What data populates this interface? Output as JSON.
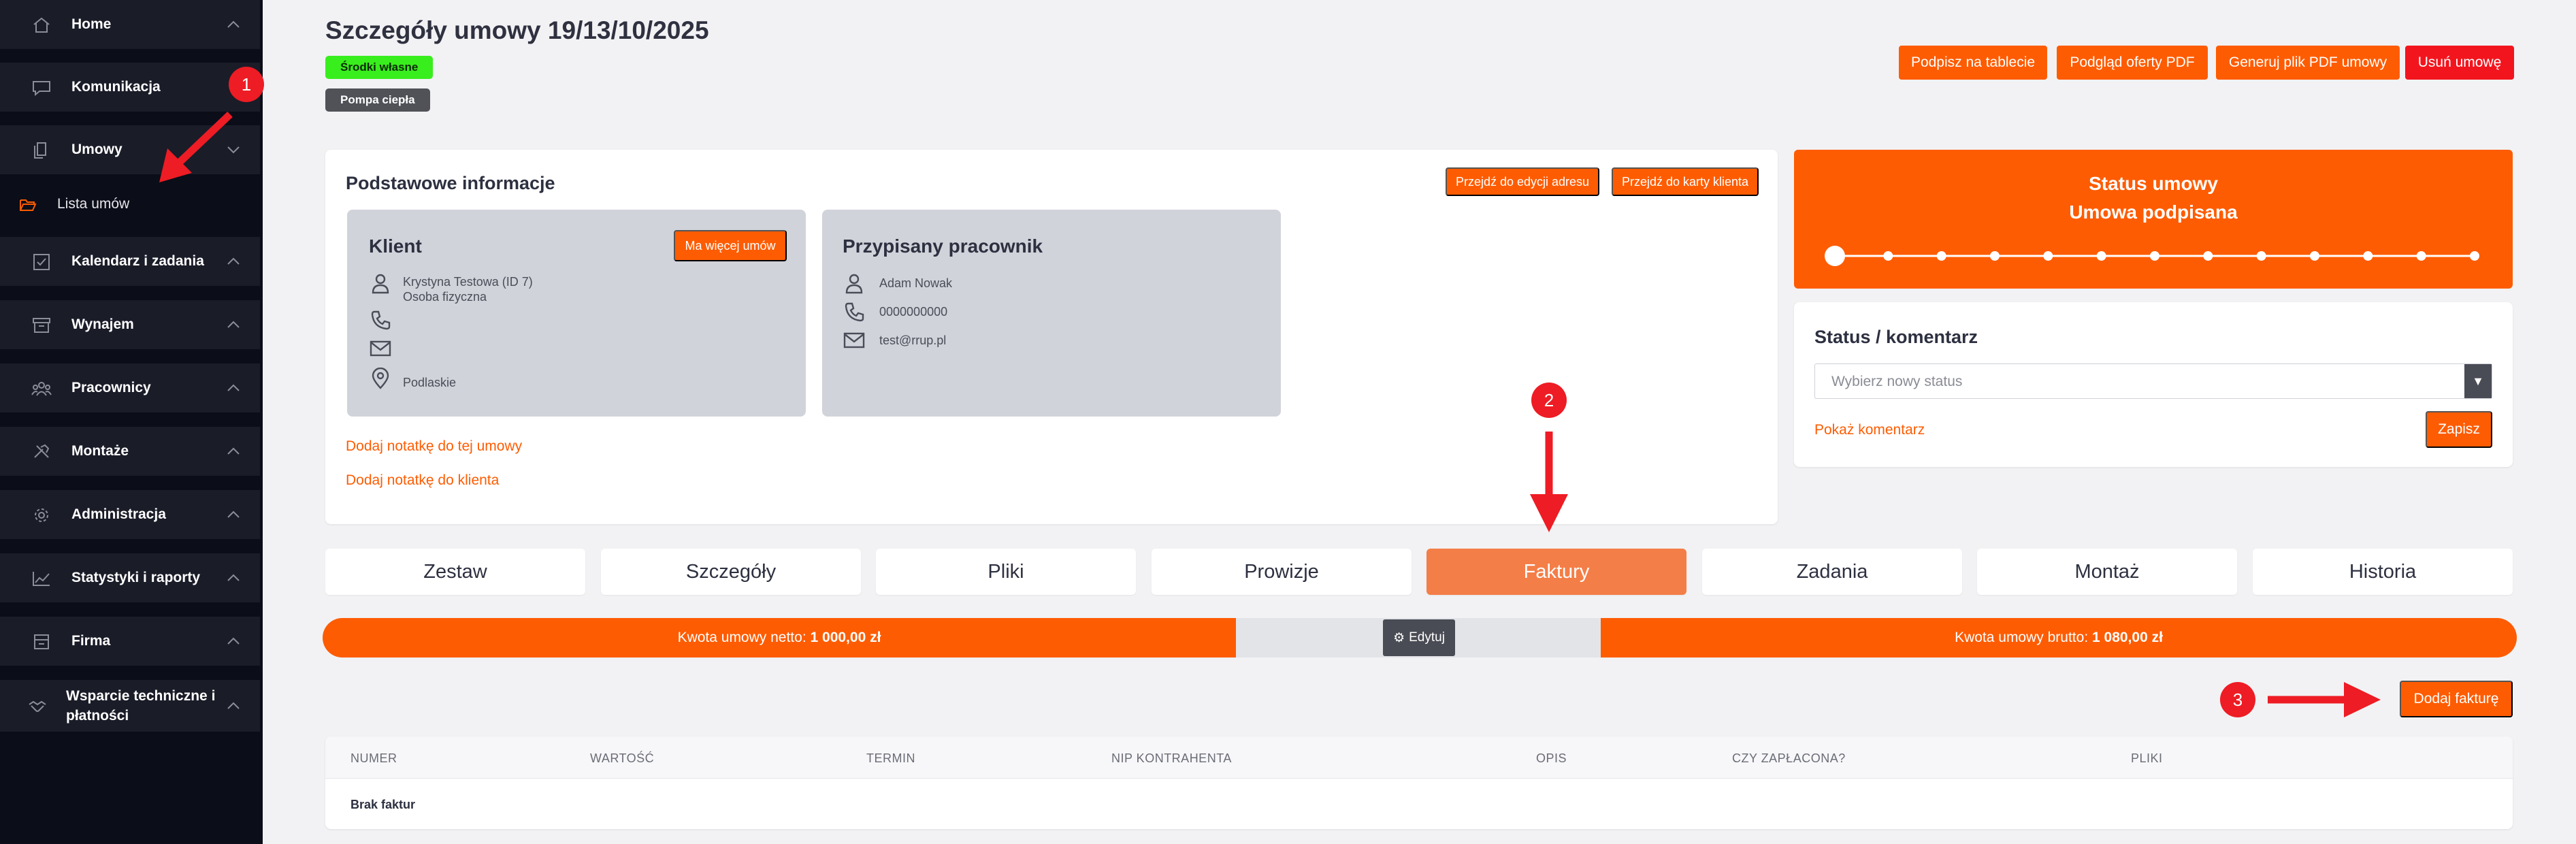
{
  "sidebar": {
    "items": [
      {
        "label": "Home",
        "icon": "home-icon"
      },
      {
        "label": "Komunikacja",
        "icon": "chat-icon"
      },
      {
        "label": "Umowy",
        "icon": "documents-icon"
      },
      {
        "label": "Kalendarz i zadania",
        "icon": "checkbox-icon"
      },
      {
        "label": "Wynajem",
        "icon": "box-icon"
      },
      {
        "label": "Pracownicy",
        "icon": "people-icon"
      },
      {
        "label": "Montaże",
        "icon": "tools-icon"
      },
      {
        "label": "Administracja",
        "icon": "gear-icon"
      },
      {
        "label": "Statystyki i raporty",
        "icon": "chart-icon"
      },
      {
        "label": "Firma",
        "icon": "building-icon"
      },
      {
        "label": "Wsparcie techniczne i płatności",
        "icon": "handshake-icon"
      }
    ],
    "sub_item": {
      "label": "Lista umów",
      "icon": "folder-open-icon"
    }
  },
  "header": {
    "title": "Szczegóły umowy 19/13/10/2025",
    "badges": [
      "Środki własne",
      "Pompa ciepła"
    ],
    "buttons": {
      "sign": "Podpisz na tablecie",
      "preview_pdf": "Podgląd oferty PDF",
      "generate_pdf": "Generuj plik PDF umowy",
      "delete": "Usuń umowę"
    }
  },
  "basic_info": {
    "title": "Podstawowe informacje",
    "edit_address_btn": "Przejdź do edycji adresu",
    "client_card_btn": "Przejdź do karty klienta",
    "client": {
      "title": "Klient",
      "more_btn": "Ma więcej umów",
      "name": "Krystyna Testowa (ID 7)",
      "type": "Osoba fizyczna",
      "region": "Podlaskie"
    },
    "employee": {
      "title": "Przypisany pracownik",
      "name": "Adam Nowak",
      "phone": "0000000000",
      "email": "test@rrup.pl"
    },
    "note_contract": "Dodaj notatkę do tej umowy",
    "note_client": "Dodaj notatkę do klienta"
  },
  "status": {
    "title": "Status umowy",
    "value": "Umowa podpisana",
    "steps_total": 13,
    "current_step": 1
  },
  "comment": {
    "title": "Status / komentarz",
    "placeholder": "Wybierz nowy status",
    "show_comment": "Pokaż komentarz",
    "save": "Zapisz"
  },
  "tabs": [
    {
      "label": "Zestaw",
      "active": false
    },
    {
      "label": "Szczegóły",
      "active": false
    },
    {
      "label": "Pliki",
      "active": false
    },
    {
      "label": "Prowizje",
      "active": false
    },
    {
      "label": "Faktury",
      "active": true
    },
    {
      "label": "Zadania",
      "active": false
    },
    {
      "label": "Montaż",
      "active": false
    },
    {
      "label": "Historia",
      "active": false
    }
  ],
  "amounts": {
    "net_label": "Kwota umowy netto: ",
    "net_value": "1 000,00 zł",
    "gross_label": "Kwota umowy brutto: ",
    "gross_value": "1 080,00 zł",
    "edit": "Edytuj"
  },
  "invoices": {
    "add_btn": "Dodaj fakturę",
    "columns": [
      "NUMER",
      "WARTOŚĆ",
      "TERMIN",
      "NIP KONTRAHENTA",
      "OPIS",
      "CZY ZAPŁACONA?",
      "PLIKI"
    ],
    "empty": "Brak faktur"
  },
  "annotations": [
    "1",
    "2",
    "3"
  ],
  "colors": {
    "accent": "#fe5c02",
    "danger": "#f2151e",
    "sidebar": "#0b0d18",
    "annotation": "#ee1c24"
  }
}
